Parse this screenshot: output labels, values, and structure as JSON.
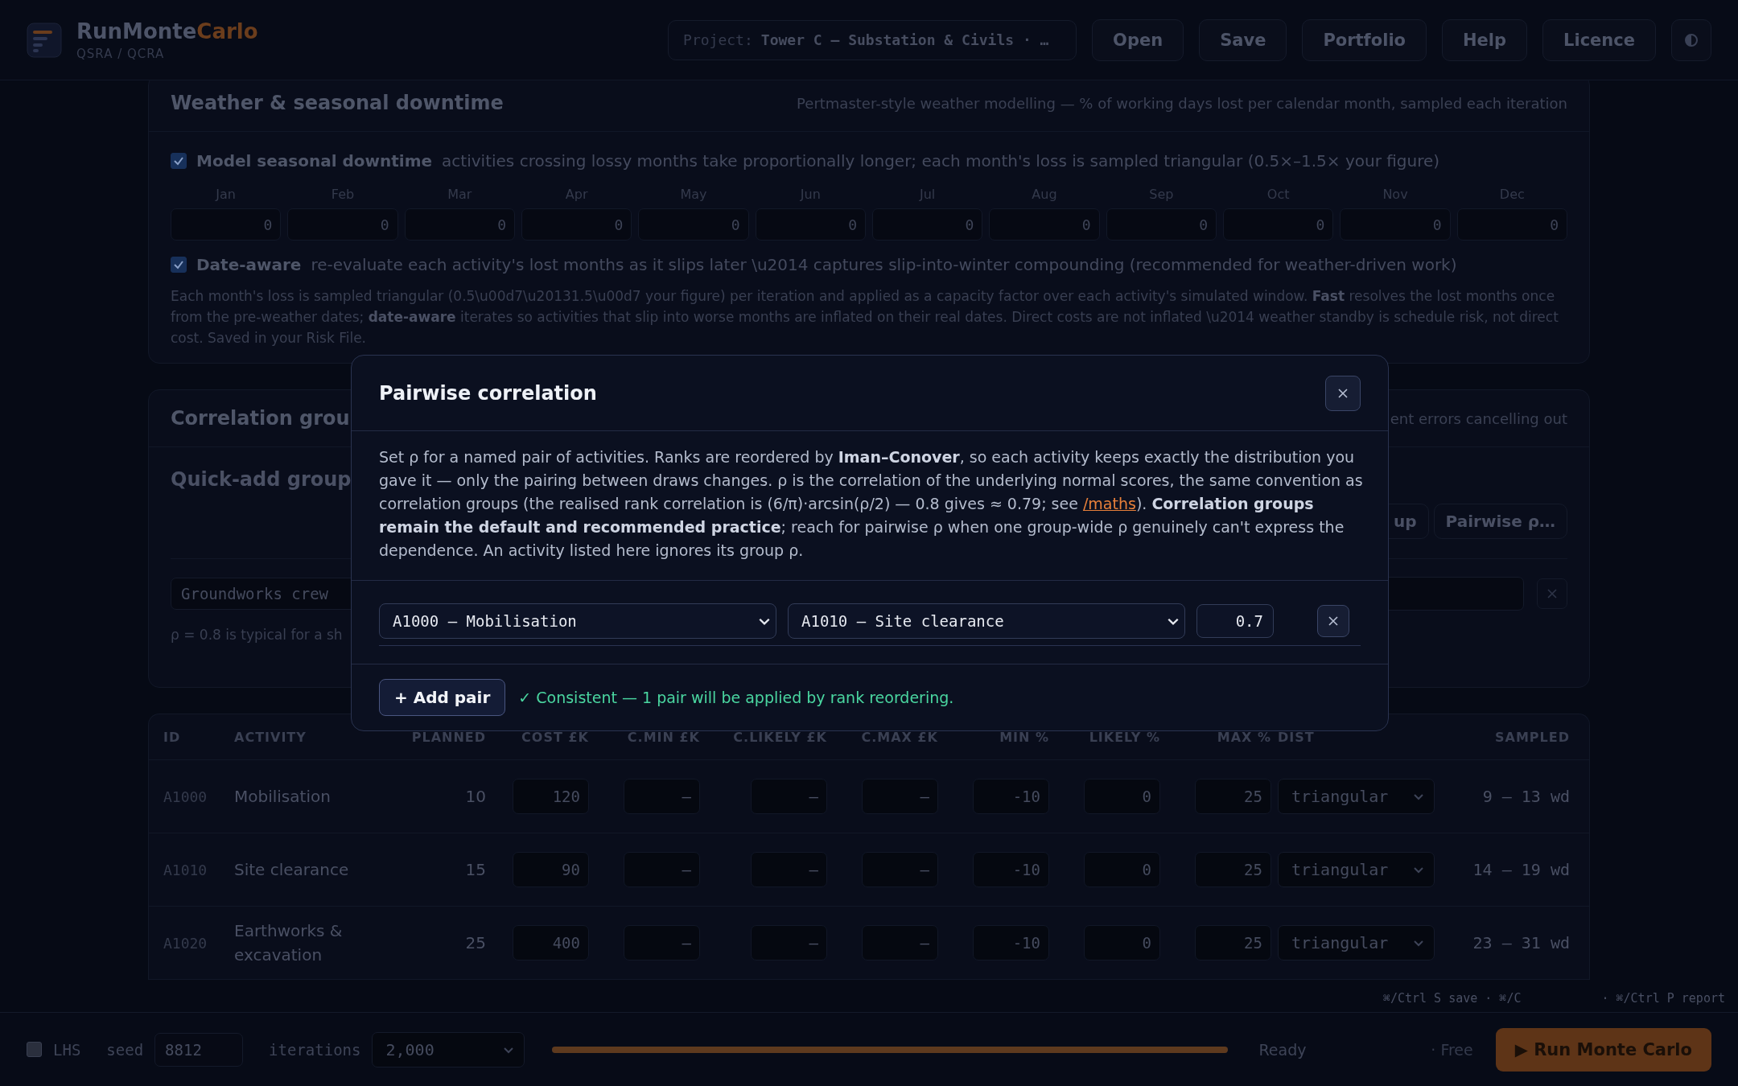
{
  "header": {
    "brand": {
      "name": "RunMonte",
      "accent": "Carlo"
    },
    "subtitle": "QSRA / QCRA",
    "project": {
      "label": "Project:",
      "value": "Tower C — Substation & Civils · …"
    },
    "buttons": [
      "Open",
      "Save",
      "Portfolio",
      "Help",
      "Licence"
    ]
  },
  "weather": {
    "title": "Weather & seasonal downtime",
    "description": "Pertmaster-style weather modelling — % of working days lost per calendar month, sampled each iteration",
    "seasonal": {
      "checked": true,
      "label": "Model seasonal downtime",
      "hint": "activities crossing lossy months take proportionally longer; each month's loss is sampled triangular (0.5×–1.5× your figure)"
    },
    "months": [
      {
        "label": "Jan",
        "value": "0"
      },
      {
        "label": "Feb",
        "value": "0"
      },
      {
        "label": "Mar",
        "value": "0"
      },
      {
        "label": "Apr",
        "value": "0"
      },
      {
        "label": "May",
        "value": "0"
      },
      {
        "label": "Jun",
        "value": "0"
      },
      {
        "label": "Jul",
        "value": "0"
      },
      {
        "label": "Aug",
        "value": "0"
      },
      {
        "label": "Sep",
        "value": "0"
      },
      {
        "label": "Oct",
        "value": "0"
      },
      {
        "label": "Nov",
        "value": "0"
      },
      {
        "label": "Dec",
        "value": "0"
      }
    ],
    "date_aware": {
      "checked": true,
      "label": "Date-aware",
      "hint": "re-evaluate each activity's lost months as it slips later \\u2014 captures slip-into-winter compounding (recommended for weather-driven work)"
    },
    "note": "Each month's loss is sampled triangular (0.5\\u00d7\\u20131.5\\u00d7 your figure) per iteration and applied as a capacity factor over each activity's simulated window. **Fast** resolves the lost months once from the pre-weather dates; **date-aware** iterates so activities that slip into worse months are inflated on their real dates. Direct costs are not inflated \\u2014 weather standby is schedule risk, not direct cost. Saved in your Risk File."
  },
  "correlation_groups": {
    "title": "Correlation grou",
    "description": "ent errors cancelling out",
    "quick_add_title": "Quick-add group",
    "buttons": [
      "up",
      "Pairwise ρ…"
    ],
    "group": {
      "name": "Groundworks crew"
    },
    "note": "ρ = 0.8 is typical for a sh"
  },
  "modal": {
    "title": "Pairwise correlation",
    "intro": {
      "before": "Set ρ for a named pair of activities. Ranks are reordered by **Iman–Conover**, so each activity keeps exactly the distribution you gave it — only the pairing between draws changes. ρ is the correlation of the underlying normal scores, the same convention as correlation groups (the realised rank correlation is (6/π)·arcsin(ρ/2) — 0.8 gives ≈ 0.79; see",
      "link": "/maths",
      "after": "). **Correlation groups remain the default and recommended practice**; reach for pairwise ρ when one group-wide ρ genuinely can't express the dependence. An activity listed here ignores its group ρ."
    },
    "pairs": [
      {
        "activity_a": "A1000 — Mobilisation",
        "activity_b": "A1010 — Site clearance",
        "rho": "0.7"
      }
    ],
    "add_button": "+ Add pair",
    "status": "✓ Consistent — 1 pair will be applied by rank reordering."
  },
  "table": {
    "columns": [
      "ID",
      "ACTIVITY",
      "PLANNED",
      "COST £K",
      "C.MIN £K",
      "C.LIKELY £K",
      "C.MAX £K",
      "MIN %",
      "LIKELY %",
      "MAX %",
      "DIST",
      "SAMPLED"
    ],
    "rows": [
      {
        "id": "A1000",
        "activity": "Mobilisation",
        "planned": "10",
        "inputs": [
          {
            "value": "120"
          },
          {
            "placeholder": "–"
          },
          {
            "placeholder": "–"
          },
          {
            "placeholder": "–"
          },
          {
            "value": "-10"
          },
          {
            "value": "0"
          },
          {
            "value": "25"
          }
        ],
        "dist": "triangular",
        "sampled": "9 – 13 wd"
      },
      {
        "id": "A1010",
        "activity": "Site clearance",
        "planned": "15",
        "inputs": [
          {
            "value": "90"
          },
          {
            "placeholder": "–"
          },
          {
            "placeholder": "–"
          },
          {
            "placeholder": "–"
          },
          {
            "value": "-10"
          },
          {
            "value": "0"
          },
          {
            "value": "25"
          }
        ],
        "dist": "triangular",
        "sampled": "14 – 19 wd"
      },
      {
        "id": "A1020",
        "activity": "Earthworks & excavation",
        "planned": "25",
        "inputs": [
          {
            "value": "400"
          },
          {
            "placeholder": "–"
          },
          {
            "placeholder": "–"
          },
          {
            "placeholder": "–"
          },
          {
            "value": "-10"
          },
          {
            "value": "0"
          },
          {
            "value": "25"
          }
        ],
        "dist": "triangular",
        "sampled": "23 – 31 wd"
      }
    ]
  },
  "shortcuts": [
    "⌘/Ctrl S save · ⌘/C",
    "· ⌘/Ctrl P report"
  ],
  "run_bar": {
    "lhs": {
      "label": "LHS",
      "checked": false
    },
    "seed": {
      "label": "seed",
      "value": "8812"
    },
    "iterations": {
      "label": "iterations",
      "value": "2,000"
    },
    "progress": {
      "level": 1
    },
    "status": "Ready",
    "plan": "· Free",
    "run_button": "▶ Run Monte Carlo"
  }
}
